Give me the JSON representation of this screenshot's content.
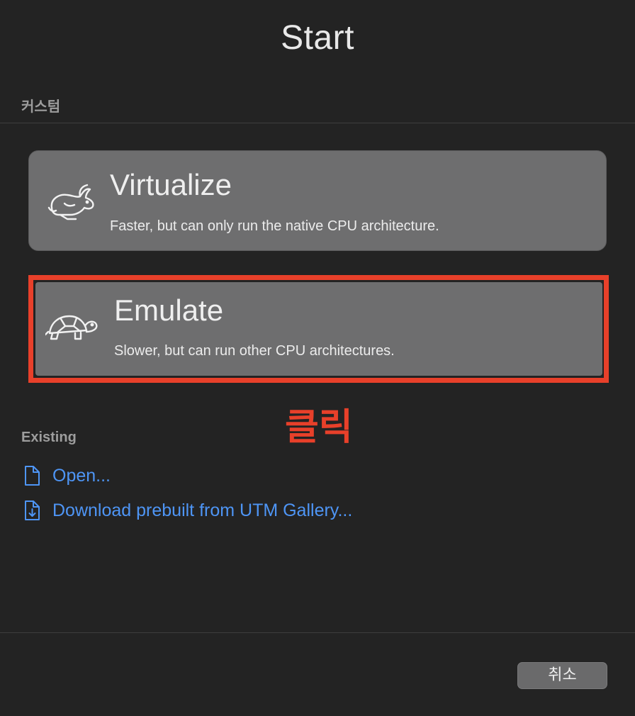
{
  "window": {
    "title": "Start"
  },
  "custom": {
    "section_label": "커스텀",
    "options": [
      {
        "title": "Virtualize",
        "description": "Faster, but can only run the native CPU architecture.",
        "icon": "rabbit-icon"
      },
      {
        "title": "Emulate",
        "description": "Slower, but can run other CPU architectures.",
        "icon": "turtle-icon"
      }
    ]
  },
  "annotation": {
    "text": "클릭",
    "color": "#e8402a"
  },
  "existing": {
    "section_label": "Existing",
    "links": [
      {
        "label": "Open...",
        "icon": "document-icon"
      },
      {
        "label": "Download prebuilt from UTM Gallery...",
        "icon": "document-download-icon"
      }
    ]
  },
  "footer": {
    "cancel_label": "취소"
  },
  "colors": {
    "background": "#232323",
    "card": "#6e6e6f",
    "link": "#4e95f5",
    "highlight": "#e8402a"
  }
}
